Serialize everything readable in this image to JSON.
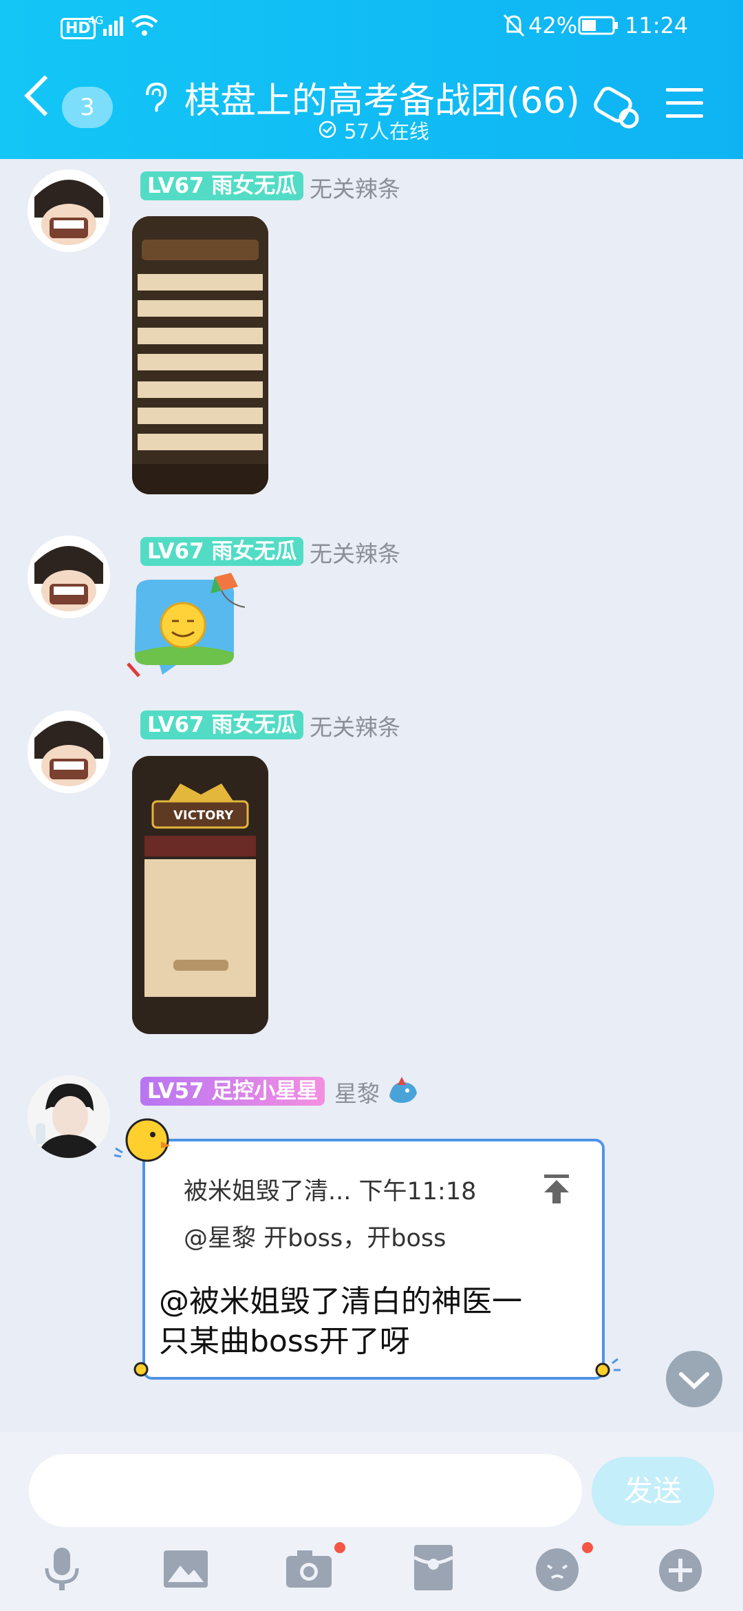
{
  "status_bar": {
    "left_label": "HD",
    "network": "4G",
    "battery": "42%",
    "time": "11:24"
  },
  "header": {
    "back_count": "3",
    "title": "棋盘上的高考备战团(66)",
    "online": "57人在线"
  },
  "messages": [
    {
      "level": "LV67",
      "title": "雨女无瓜",
      "name": "无关辣条",
      "type": "image"
    },
    {
      "level": "LV67",
      "title": "雨女无瓜",
      "name": "无关辣条",
      "type": "sticker"
    },
    {
      "level": "LV67",
      "title": "雨女无瓜",
      "name": "无关辣条",
      "type": "image",
      "image_text": "VICTORY"
    },
    {
      "level": "LV57",
      "title": "足控小星星",
      "name": "星黎",
      "type": "reply",
      "quote_header": "被米姐毁了清... 下午11:18",
      "quote_text": "@星黎 开boss，开boss",
      "text_line1": "@被米姐毁了清白的神医一",
      "text_line2": "只某曲boss开了呀"
    }
  ],
  "input": {
    "placeholder": ""
  },
  "send_label": "发送",
  "icons": {
    "voice": "microphone-icon",
    "image": "image-icon",
    "camera": "camera-icon",
    "redpacket": "red-packet-icon",
    "emoji": "emoji-icon",
    "more": "plus-icon"
  },
  "colors": {
    "header": "#13c6f6",
    "level_green": "#52dcc5",
    "level_purple": "#b775f3",
    "reply_border": "#4f94e8"
  }
}
